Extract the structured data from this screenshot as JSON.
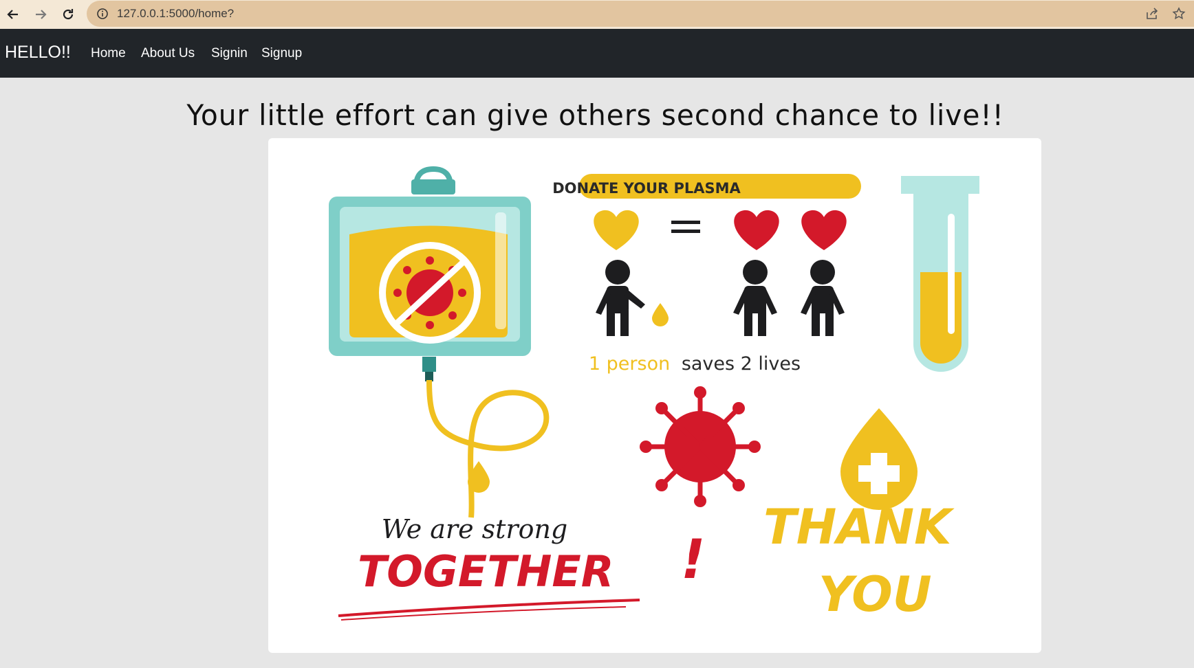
{
  "browser": {
    "url": "127.0.0.1:5000/home?",
    "icons": [
      "back-arrow-icon",
      "forward-arrow-icon",
      "reload-icon",
      "info-icon",
      "share-icon",
      "star-icon"
    ]
  },
  "navbar": {
    "brand": "HELLO!!",
    "links": [
      "Home",
      "About Us",
      "Signin",
      "Signup"
    ]
  },
  "main": {
    "headline": "Your little effort can give others second chance to live!!"
  },
  "poster": {
    "banner": "DONATE YOUR PLASMA",
    "caption_highlight": "1 person",
    "caption_rest": "saves 2 lives",
    "slogan_top": "We are strong",
    "slogan_main": "TOGETHER",
    "slogan_bang": "!",
    "thanks_1": "THANK",
    "thanks_2": "YOU",
    "colors": {
      "yellow": "#f0c020",
      "red": "#d3192a",
      "teal": "#7fcfc8",
      "dark": "#1d1d1f"
    }
  }
}
